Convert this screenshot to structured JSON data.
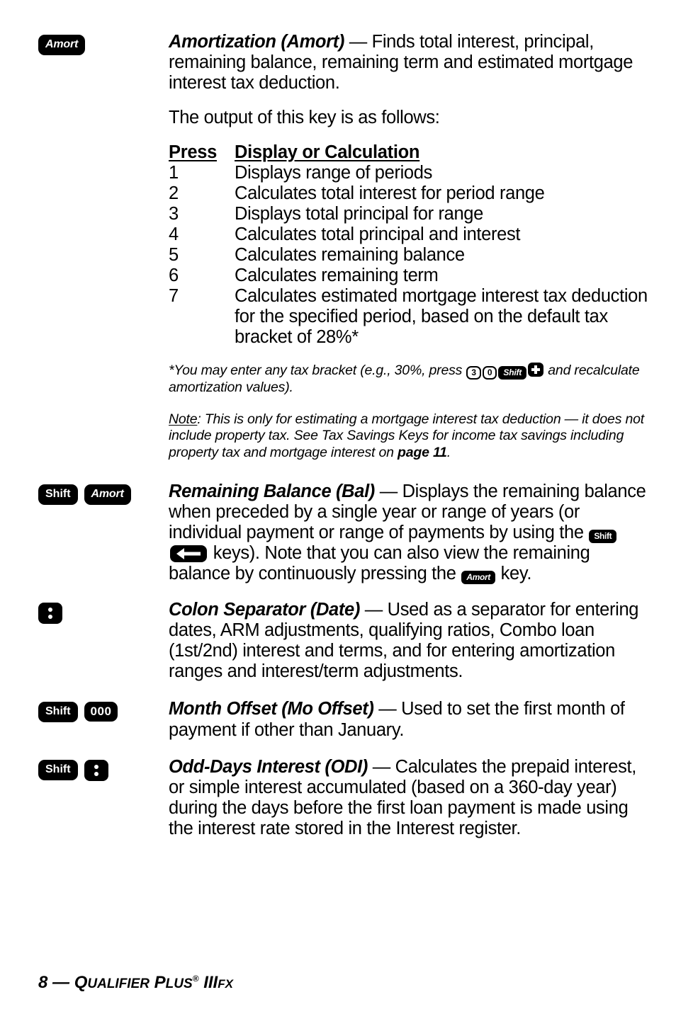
{
  "page": {
    "footer": {
      "page_number": "8",
      "dash": "—",
      "brand_q": "Q",
      "brand_qualifier": "UALIFIER",
      "brand_p": "P",
      "brand_plus": "LUS",
      "registered": "®",
      "model_roman": "III",
      "model_fx": "FX"
    }
  },
  "entries": [
    {
      "id": "amortization",
      "keys": [
        {
          "type": "pill-italic",
          "label": "Amort",
          "name": "amort-key"
        }
      ],
      "lead": "Amortization (Amort)",
      "dash": " — ",
      "body": "Finds total interest, principal, remaining balance, remaining term and estimated mortgage interest tax deduction.",
      "intro": "The output of this key is as follows:",
      "table": {
        "headers": [
          "Press",
          "Display or Calculation"
        ],
        "rows": [
          {
            "press": "1",
            "desc": "Displays range of periods"
          },
          {
            "press": "2",
            "desc": "Calculates total interest for period range"
          },
          {
            "press": "3",
            "desc": "Displays total principal for range"
          },
          {
            "press": "4",
            "desc": "Calculates total principal and interest"
          },
          {
            "press": "5",
            "desc": "Calculates remaining balance"
          },
          {
            "press": "6",
            "desc": "Calculates remaining term"
          },
          {
            "press": "7",
            "desc": "Calculates estimated mortgage interest tax deduction for the specified period, based on the default tax bracket of 28%*"
          }
        ]
      },
      "footnote": {
        "part1": "*You may enter any tax bracket (e.g., 30%, press ",
        "key_3": "3",
        "key_0": "0",
        "key_shift": "Shift",
        "key_plus": "plus-icon",
        "part2": " and recalculate amortization values)."
      },
      "note": {
        "label": "Note",
        "colon": ": ",
        "text1": "This is only for estimating a mortgage interest tax deduction — it does not include property tax. See Tax Savings Keys for income tax savings including property tax and mortgage interest on ",
        "bold_ref": "page 11",
        "text2": "."
      }
    },
    {
      "id": "remaining-balance",
      "keys": [
        {
          "type": "pill",
          "label": "Shift",
          "name": "shift-key"
        },
        {
          "type": "pill-italic",
          "label": "Amort",
          "name": "amort-key"
        }
      ],
      "lead": "Remaining Balance (Bal)",
      "dash": " — ",
      "body_part1": "Displays the remaining balance when preceded by a single year or range of years (or individual payment or range of payments by using the ",
      "inline_shift": "Shift",
      "inline_arrow": "left-arrow-icon",
      "body_part2": " keys). Note that you can also view the remaining balance by continuously pressing the ",
      "inline_amort": "Amort",
      "body_part3": " key."
    },
    {
      "id": "colon-separator",
      "keys": [
        {
          "type": "colon",
          "label": "colon-icon",
          "name": "colon-key"
        }
      ],
      "lead": "Colon Separator (Date)",
      "dash": " — ",
      "body": "Used as a separator for entering dates, ARM adjustments, qualifying ratios, Combo loan (1st/2nd) interest and terms, and for entering amortization ranges and interest/term adjustments."
    },
    {
      "id": "month-offset",
      "keys": [
        {
          "type": "pill",
          "label": "Shift",
          "name": "shift-key"
        },
        {
          "type": "pill",
          "label": "000",
          "name": "triple-zero-key"
        }
      ],
      "lead": "Month Offset (Mo Offset)",
      "dash": " — ",
      "body": "Used to set the first month of payment if other than January."
    },
    {
      "id": "odd-days-interest",
      "keys": [
        {
          "type": "pill",
          "label": "Shift",
          "name": "shift-key"
        },
        {
          "type": "colon",
          "label": "colon-icon",
          "name": "colon-key"
        }
      ],
      "lead": "Odd-Days Interest (ODI)",
      "dash": " — ",
      "body": "Calculates the prepaid interest, or simple interest accumulated (based on a 360-day year) during the days before the first loan payment is made using the interest rate stored in the Interest register."
    }
  ]
}
